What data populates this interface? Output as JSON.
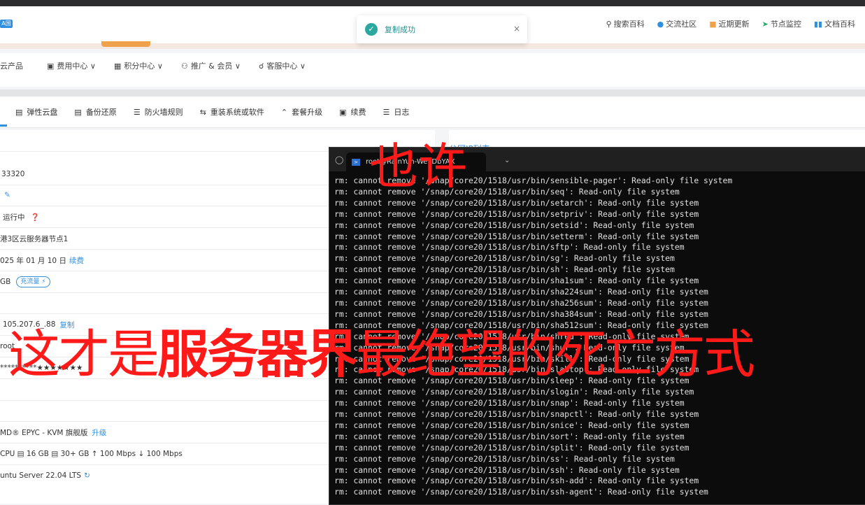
{
  "header": {
    "logo_badge": "A国",
    "links": [
      {
        "icon": "search-icon",
        "label": "搜索百科"
      },
      {
        "icon": "bell-icon",
        "label": "交流社区"
      },
      {
        "icon": "gift-icon",
        "label": "近期更新"
      },
      {
        "icon": "send-icon",
        "label": "节点监控"
      },
      {
        "icon": "book-icon",
        "label": "文档百科"
      }
    ]
  },
  "toast": {
    "message": "复制成功",
    "close": "×"
  },
  "nav": {
    "items": [
      {
        "label": "云产品"
      },
      {
        "label": "费用中心 ∨"
      },
      {
        "label": "积分中心 ∨"
      },
      {
        "label": "推广 & 会员 ∨"
      },
      {
        "label": "客服中心 ∨"
      }
    ]
  },
  "tabs": {
    "items": [
      {
        "label": "弹性云盘"
      },
      {
        "label": "备份还原"
      },
      {
        "label": "防火墙规则"
      },
      {
        "label": "重装系统或软件"
      },
      {
        "label": "套餐升级"
      },
      {
        "label": "续费"
      },
      {
        "label": "日志"
      }
    ]
  },
  "info": {
    "id": "33320",
    "status": "运行中",
    "node": "港3区云服务器节点1",
    "expire": "025 年 01 月 10 日",
    "renew": "续费",
    "traffic": "GB",
    "traffic_pill": "充流量 ⚡",
    "ip": "105.207.6_.88",
    "copy": "复制",
    "user": "root",
    "password": "**********★★★★★★★",
    "cpu_model": "MD® EPYC - KVM 旗舰版",
    "upgrade": "升级",
    "spec": "CPU   ▤ 16 GB   ▤ 30+ GB  ↑ 100 Mbps   ↓ 100 Mbps",
    "os": "untu Server 22.04 LTS"
  },
  "right_card": {
    "title": "公网IP列表"
  },
  "terminal": {
    "tab_title": "root@RainYun-WeYDbYAX",
    "lines": [
      "rm: cannot remove '/snap/core20/1518/usr/bin/sensible-pager': Read-only file system",
      "rm: cannot remove '/snap/core20/1518/usr/bin/seq': Read-only file system",
      "rm: cannot remove '/snap/core20/1518/usr/bin/setarch': Read-only file system",
      "rm: cannot remove '/snap/core20/1518/usr/bin/setpriv': Read-only file system",
      "rm: cannot remove '/snap/core20/1518/usr/bin/setsid': Read-only file system",
      "rm: cannot remove '/snap/core20/1518/usr/bin/setterm': Read-only file system",
      "rm: cannot remove '/snap/core20/1518/usr/bin/sftp': Read-only file system",
      "rm: cannot remove '/snap/core20/1518/usr/bin/sg': Read-only file system",
      "rm: cannot remove '/snap/core20/1518/usr/bin/sh': Read-only file system",
      "rm: cannot remove '/snap/core20/1518/usr/bin/sha1sum': Read-only file system",
      "rm: cannot remove '/snap/core20/1518/usr/bin/sha224sum': Read-only file system",
      "rm: cannot remove '/snap/core20/1518/usr/bin/sha256sum': Read-only file system",
      "rm: cannot remove '/snap/core20/1518/usr/bin/sha384sum': Read-only file system",
      "rm: cannot remove '/snap/core20/1518/usr/bin/sha512sum': Read-only file system",
      "rm: cannot remove '/snap/core20/1518/usr/bin/shred': Read-only file system",
      "rm: cannot remove '/snap/core20/1518/usr/bin/shuf': Read-only file system",
      "rm: cannot remove '/snap/core20/1518/usr/bin/skill': Read-only file system",
      "rm: cannot remove '/snap/core20/1518/usr/bin/slabtop': Read-only file system",
      "rm: cannot remove '/snap/core20/1518/usr/bin/sleep': Read-only file system",
      "rm: cannot remove '/snap/core20/1518/usr/bin/slogin': Read-only file system",
      "rm: cannot remove '/snap/core20/1518/usr/bin/snap': Read-only file system",
      "rm: cannot remove '/snap/core20/1518/usr/bin/snapctl': Read-only file system",
      "rm: cannot remove '/snap/core20/1518/usr/bin/snice': Read-only file system",
      "rm: cannot remove '/snap/core20/1518/usr/bin/sort': Read-only file system",
      "rm: cannot remove '/snap/core20/1518/usr/bin/split': Read-only file system",
      "rm: cannot remove '/snap/core20/1518/usr/bin/ss': Read-only file system",
      "rm: cannot remove '/snap/core20/1518/usr/bin/ssh': Read-only file system",
      "rm: cannot remove '/snap/core20/1518/usr/bin/ssh-add': Read-only file system",
      "rm: cannot remove '/snap/core20/1518/usr/bin/ssh-agent': Read-only file system"
    ]
  },
  "overlay": {
    "top": "也许",
    "part1": "这才是",
    "part2": "服务器界",
    "part3": "最绝望的死亡方式"
  }
}
